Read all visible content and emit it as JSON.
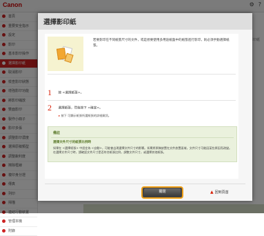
{
  "app": {
    "brand": "Canon",
    "header_icons": [
      "⚙",
      "?"
    ]
  },
  "sidebar": {
    "items": [
      {
        "label": "首頁",
        "highlight": false
      },
      {
        "label": "重要安全指示",
        "highlight": false
      },
      {
        "label": "設定",
        "highlight": false
      },
      {
        "label": "影印",
        "highlight": false
      },
      {
        "label": "基本影印操作",
        "highlight": false
      },
      {
        "label": "選擇影印紙",
        "highlight": true
      },
      {
        "label": "取消影印",
        "highlight": false
      },
      {
        "label": "檢查影印狀態",
        "highlight": false
      },
      {
        "label": "增強影印功能",
        "highlight": false
      },
      {
        "label": "將影印縮放",
        "highlight": false
      },
      {
        "label": "雙面影印",
        "highlight": false
      },
      {
        "label": "製作小冊子",
        "highlight": false
      },
      {
        "label": "影印多張",
        "highlight": false
      },
      {
        "label": "調整影印濃度",
        "highlight": false
      },
      {
        "label": "選擇原稿類型",
        "highlight": false
      },
      {
        "label": "調整銳利度",
        "highlight": false
      },
      {
        "label": "擦除框線",
        "highlight": false
      },
      {
        "label": "複印身分證",
        "highlight": false
      },
      {
        "label": "傳真",
        "highlight": false
      },
      {
        "label": "列印",
        "highlight": false
      },
      {
        "label": "掃描",
        "highlight": false
      },
      {
        "label": "連結行動裝置",
        "highlight": false
      },
      {
        "label": "管理本機",
        "highlight": false
      },
      {
        "label": "附錄",
        "highlight": false
      }
    ]
  },
  "main_ghost": {
    "ghost_text": "選擇影印紙"
  },
  "modal": {
    "title": "選擇影印紙",
    "intro": "若要影印在不同紙張尺寸的文件，或是想要使用多用途紙盤中的紙張進行影印，則必須手動選擇紙張。",
    "steps": [
      {
        "num": "1",
        "text": "按 <選擇紙張>。"
      },
      {
        "num": "2",
        "text": "選擇紙張，然後按下 <確定>。"
      }
    ],
    "hint": "按下     可顯示紙張所選紙張的詳細資訊。",
    "note": {
      "heading": "備註",
      "subheading": "選擇文件尺寸的紙張比例時",
      "text": "如果在 <選擇紙張> 中設定為 <自動>，可能會出現選擇文件尺寸的影響。如果將原稿放置在文件放置區域，文件尺寸可能因某些原因而改變。在選擇文件尺寸時，請確認文件尺寸是否符合紙張比例，調整文件尺寸，或選擇其他紙張。"
    },
    "back_to_top": "回到頁首",
    "close_label": "關閉"
  },
  "colors": {
    "accent_red": "#d81e05",
    "button_outline": "#f0a018",
    "note_green": "#eaf1dd"
  }
}
